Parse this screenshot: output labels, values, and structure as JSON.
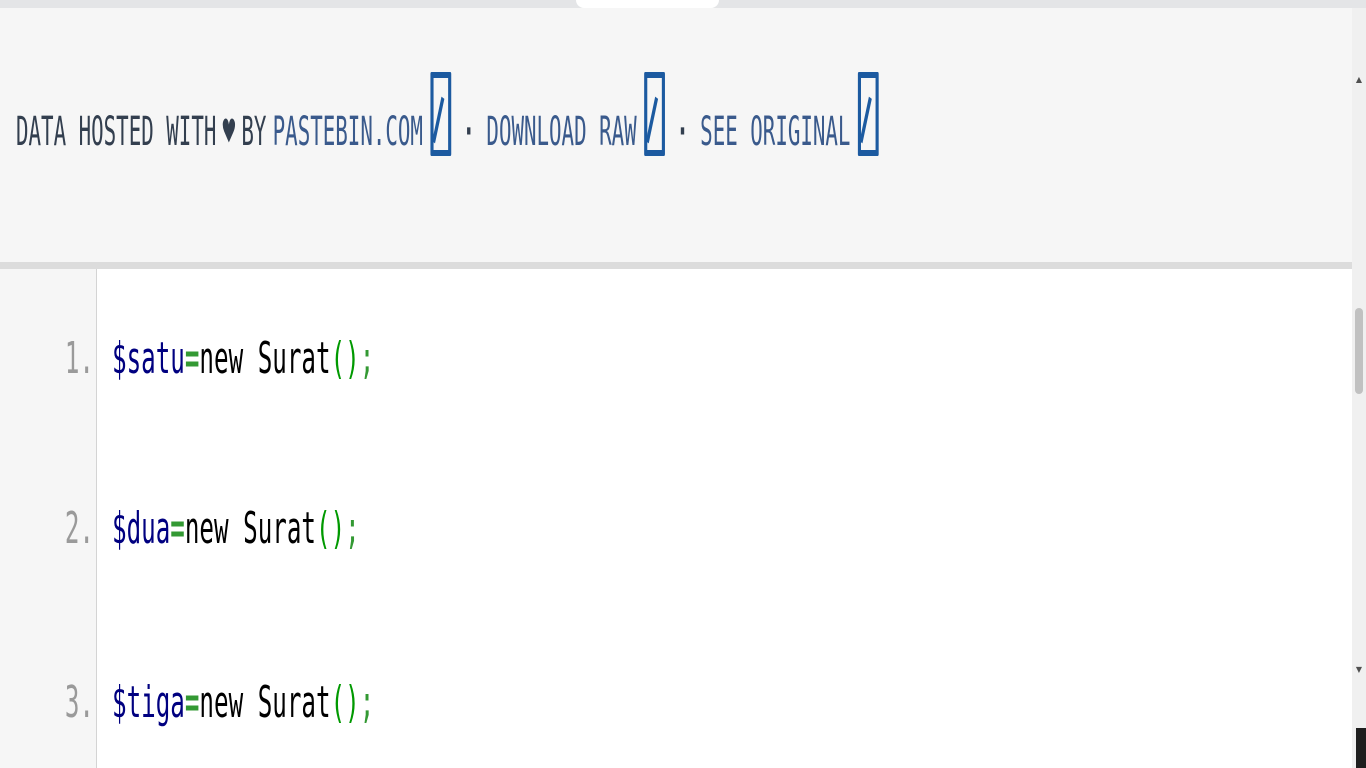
{
  "credit": {
    "prefix": "DATA HOSTED WITH",
    "heart": "♥",
    "by": "BY",
    "site_link": "PASTEBIN.COM",
    "separator": "·",
    "raw_link": "DOWNLOAD RAW",
    "original_link": "SEE ORIGINAL"
  },
  "icons": {
    "external": "external-link-icon"
  },
  "colors": {
    "header_bg": "#f6f6f6",
    "link": "#3a5a8c",
    "icon": "#1c5aa0",
    "variable": "#000080",
    "operator": "#339933",
    "paren": "#009900"
  },
  "code": {
    "lines": [
      {
        "number": "1.",
        "var": "$satu",
        "op": "=",
        "kw": "new",
        "cls": "Surat",
        "paren_open": "(",
        "paren_close": ")",
        "semi": ";"
      },
      {
        "number": "2.",
        "var": "$dua",
        "op": "=",
        "kw": "new",
        "cls": "Surat",
        "paren_open": "(",
        "paren_close": ")",
        "semi": ";"
      },
      {
        "number": "3.",
        "var": "$tiga",
        "op": "=",
        "kw": "new",
        "cls": "Surat",
        "paren_open": "(",
        "paren_close": ")",
        "semi": ";"
      }
    ]
  },
  "scrollbar": {
    "up_arrow": "▲",
    "down_arrow": "▼"
  }
}
